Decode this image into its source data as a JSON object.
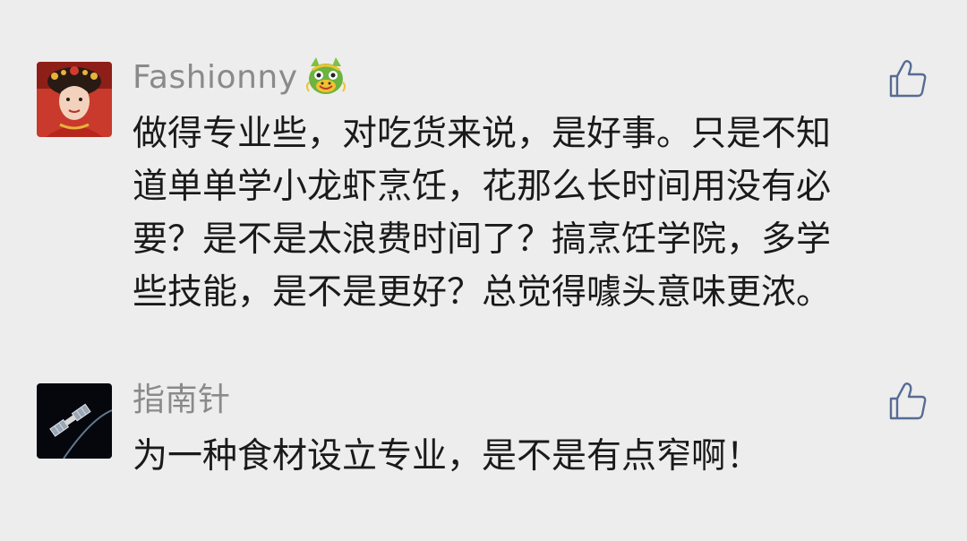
{
  "comments": [
    {
      "username": "Fashionny",
      "avatar": "avatar-woman-traditional-headdress",
      "badge_icon": "dragon-emoji-icon",
      "like_icon": "thumbs-up-icon",
      "text": "做得专业些，对吃货来说，是好事。只是不知\n道单单学小龙虾烹饪，花那么长时间用没有必\n要？是不是太浪费时间了？搞烹饪学院，多学\n些技能，是不是更好？总觉得噱头意味更浓。"
    },
    {
      "username": "指南针",
      "avatar": "avatar-satellite-space",
      "like_icon": "thumbs-up-icon",
      "text": "为一种食材设立专业，是不是有点窄啊！"
    }
  ],
  "colors": {
    "background": "#ededed",
    "username": "#8a8a8a",
    "text": "#1a1a1a",
    "like_icon": "#576b95"
  }
}
